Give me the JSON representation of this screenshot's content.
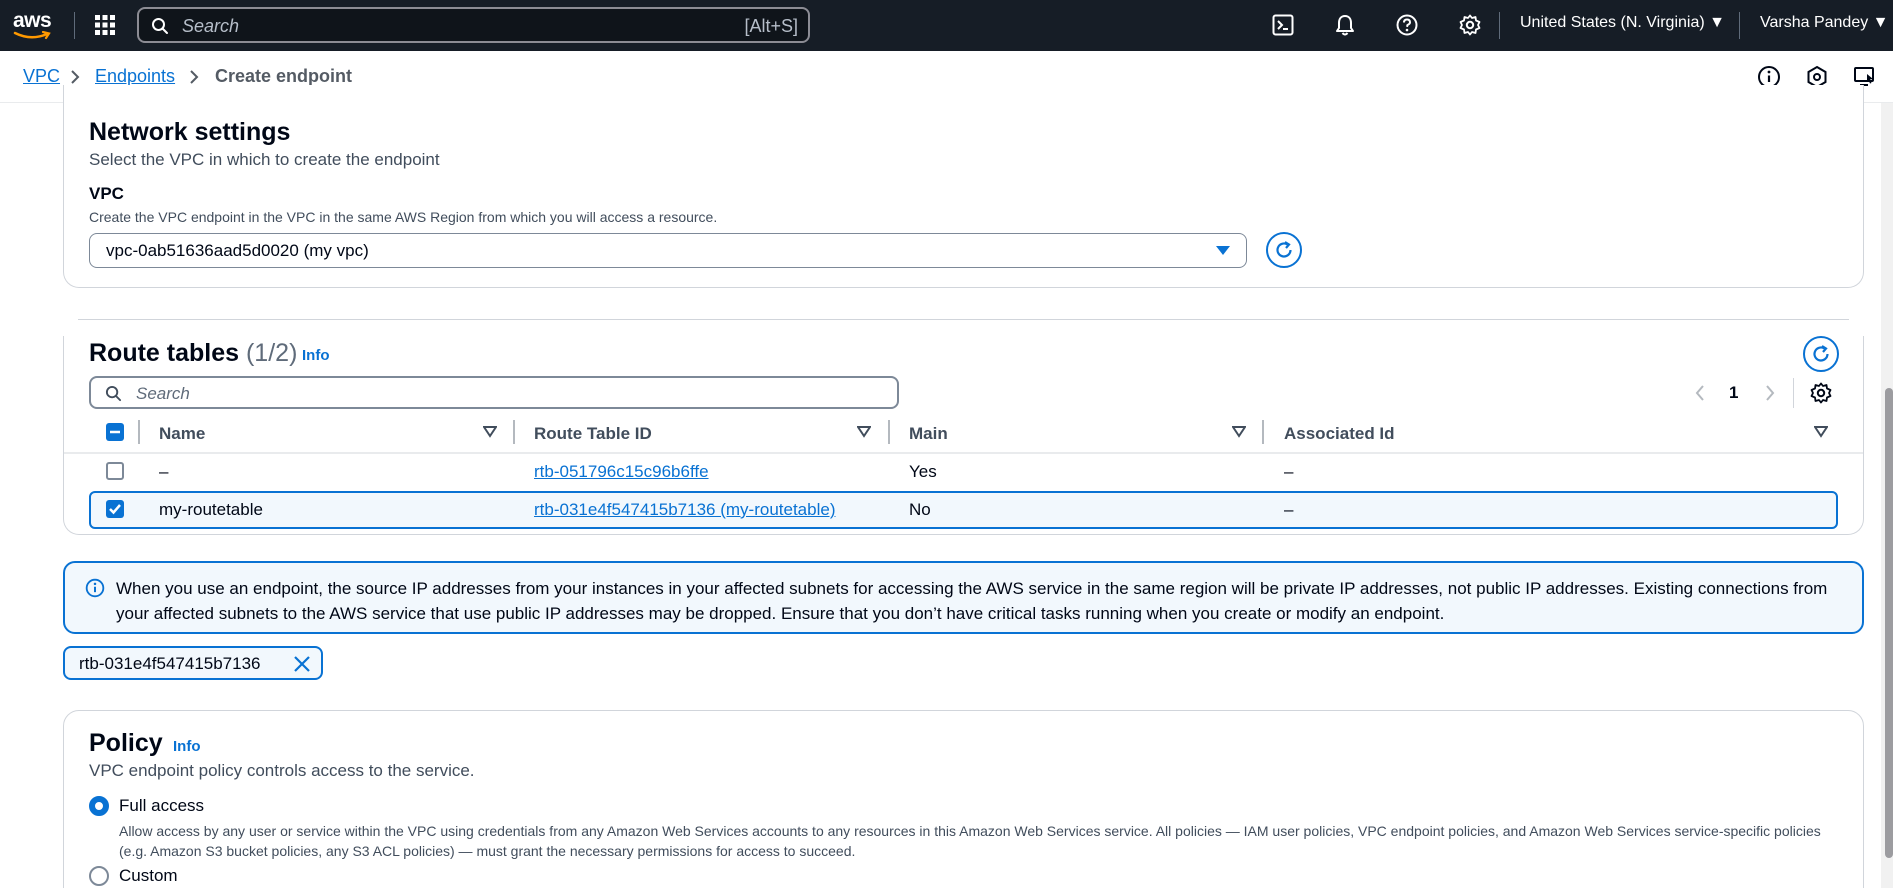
{
  "topnav": {
    "logo_text": "aws",
    "search": {
      "placeholder": "Search",
      "shortcut": "[Alt+S]"
    },
    "region": "United States (N. Virginia) ▼",
    "user": "Varsha Pandey ▼",
    "icons": [
      "apps-grid-icon",
      "cloudshell-icon",
      "bell-icon",
      "help-icon",
      "gear-icon"
    ]
  },
  "breadcrumb": {
    "items": [
      {
        "label": "VPC"
      },
      {
        "label": "Endpoints"
      },
      {
        "label": "Create endpoint"
      }
    ],
    "utility_icons": [
      "info-icon",
      "feedback-icon",
      "screen-icon"
    ]
  },
  "network_settings": {
    "title": "Network settings",
    "description": "Select the VPC in which to create the endpoint",
    "vpc_label": "VPC",
    "vpc_description": "Create the VPC endpoint in the VPC in the same AWS Region from which you will access a resource.",
    "vpc_value": "vpc-0ab51636aad5d0020 (my vpc)"
  },
  "route_tables": {
    "title": "Route tables",
    "count": "(1/2)",
    "info": "Info",
    "search_placeholder": "Search",
    "page_number": "1",
    "columns": [
      "Name",
      "Route Table ID",
      "Main",
      "Associated Id"
    ],
    "rows": [
      {
        "selected": false,
        "name": "–",
        "route_table_id": "rtb-051796c15c96b6ffe",
        "main": "Yes",
        "associated_id": "–"
      },
      {
        "selected": true,
        "name": "my-routetable",
        "route_table_id": "rtb-031e4f547415b7136 (my-routetable)",
        "main": "No",
        "associated_id": "–"
      }
    ]
  },
  "alert": {
    "text": "When you use an endpoint, the source IP addresses from your instances in your affected subnets for accessing the AWS service in the same region will be private IP addresses, not public IP addresses. Existing connections from your affected subnets to the AWS service that use public IP addresses may be dropped. Ensure that you don’t have critical tasks running when you create or modify an endpoint."
  },
  "token": {
    "label": "rtb-031e4f547415b7136"
  },
  "policy": {
    "title": "Policy",
    "info": "Info",
    "description": "VPC endpoint policy controls access to the service.",
    "options": [
      {
        "label": "Full access",
        "selected": true,
        "description": "Allow access by any user or service within the VPC using credentials from any Amazon Web Services accounts to any resources in this Amazon Web Services service. All policies — IAM user policies, VPC endpoint policies, and Amazon Web Services service-specific policies (e.g. Amazon S3 bucket policies, any S3 ACL policies) — must grant the necessary permissions for access to succeed."
      },
      {
        "label": "Custom",
        "selected": false
      }
    ]
  },
  "colors": {
    "nav_bg": "#161d26",
    "link": "#0972d3",
    "border": "#d1d5db",
    "alert_bg": "#f2f8fd"
  }
}
